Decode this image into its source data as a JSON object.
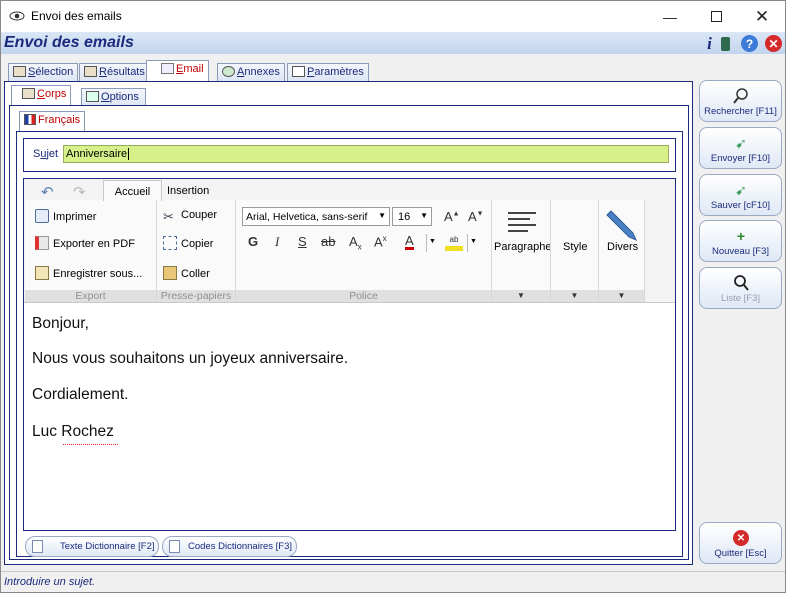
{
  "window": {
    "title": "Envoi des emails"
  },
  "header": {
    "title": "Envoi des emails"
  },
  "main_tabs": [
    {
      "label": "Sélection",
      "accel": "S",
      "rest": "élection"
    },
    {
      "label": "Résultats",
      "accel": "R",
      "rest": "ésultats"
    },
    {
      "label": "Email",
      "accel": "E",
      "rest": "mail"
    },
    {
      "label": "Annexes",
      "accel": "A",
      "rest": "nnexes"
    },
    {
      "label": "Paramètres",
      "accel": "P",
      "rest": "aramètres"
    }
  ],
  "sub_tabs": [
    {
      "label": "Corps",
      "accel": "C",
      "rest": "orps"
    },
    {
      "label": "Options",
      "accel": "O",
      "rest": "ptions"
    }
  ],
  "lang_tab": {
    "label": "Français"
  },
  "subject": {
    "label": "Sujet",
    "accel": "u",
    "pre": "S",
    "post": "jet",
    "value": "Anniversaire"
  },
  "ribbon": {
    "tabs": [
      "Accueil",
      "Insertion"
    ],
    "export": {
      "print": "Imprimer",
      "pdf": "Exporter en PDF",
      "save_as": "Enregistrer sous...",
      "group": "Export"
    },
    "clipboard": {
      "cut": "Couper",
      "copy": "Copier",
      "paste": "Coller",
      "group": "Presse-papiers"
    },
    "font": {
      "family": "Arial, Helvetica, sans-serif",
      "size": "16",
      "group": "Police",
      "bold": "G",
      "italic": "I",
      "underline": "S",
      "strike": "ab"
    },
    "paragraph": "Paragraphe",
    "style": "Style",
    "divers": "Divers"
  },
  "editor": {
    "lines": [
      "Bonjour,",
      "Nous vous souhaitons un joyeux anniversaire.",
      "Cordialement.",
      "Luc Rochez"
    ]
  },
  "dict_buttons": {
    "texte": "Texte Dictionnaire [F2]",
    "codes": "Codes Dictionnaires [F3]"
  },
  "side_buttons": {
    "search": "Rechercher [F11]",
    "send": "Envoyer [F10]",
    "save": "Sauver [cF10]",
    "new": "Nouveau [F3]",
    "list": "Liste [F3]",
    "quit": "Quitter [Esc]"
  },
  "status": {
    "text": "Introduire un sujet."
  },
  "colors": {
    "accent": "#1b2a7c",
    "subject_bg": "#d8f08a",
    "active_tab": "#c00000",
    "header_bg": "#c2d5ee"
  }
}
